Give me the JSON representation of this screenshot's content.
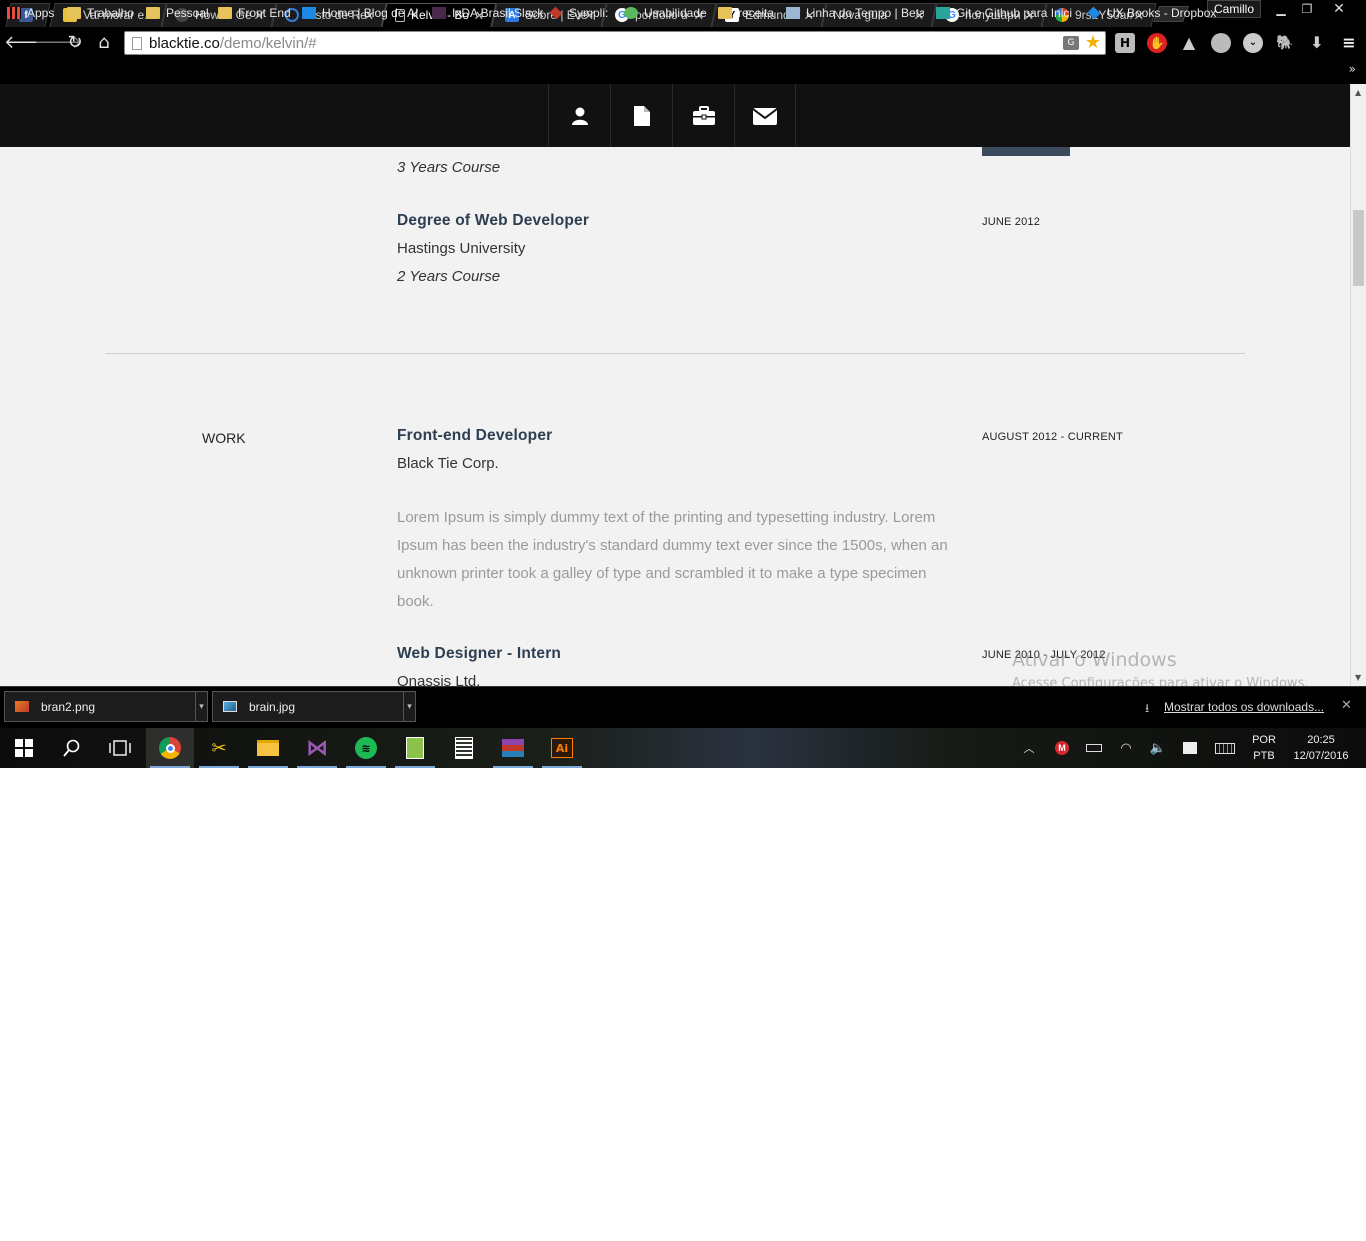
{
  "browser": {
    "tabs": [
      {
        "label": "",
        "icon": "facebook-icon",
        "color": "#3b5998",
        "glyph": "f"
      },
      {
        "label": "Vai morar e",
        "icon": "image-icon",
        "color": "#e8c13a",
        "glyph": ""
      },
      {
        "label": "How to Ge",
        "icon": "github-icon",
        "color": "#444444",
        "glyph": ""
      },
      {
        "label": "Visto de Re",
        "icon": "search-icon",
        "color": "#3a7bd5",
        "glyph": ""
      },
      {
        "label": "Kelvin - Bo",
        "icon": "page-icon",
        "color": "#ffffff",
        "glyph": "",
        "active": true
      },
      {
        "label": "Sobre | Eve",
        "icon": "evernote-icon",
        "color": "#2d7be0",
        "glyph": ""
      },
      {
        "label": "portfolio u",
        "icon": "google-icon",
        "color": "#ffffff",
        "glyph": "G"
      },
      {
        "label": "Edmund Y",
        "icon": "ym-icon",
        "color": "#ffffff",
        "glyph": "Y"
      },
      {
        "label": "Nova guia",
        "icon": "",
        "color": "",
        "glyph": ""
      },
      {
        "label": "полушари",
        "icon": "google-icon",
        "color": "#ffffff",
        "glyph": "G"
      },
      {
        "label": "9rs2Y50ar/",
        "icon": "pinwheel-icon",
        "color": "#e34a2a",
        "glyph": ""
      }
    ],
    "profile_name": "Camillo",
    "url_host": "blacktie.co",
    "url_path": "/demo/kelvin/#",
    "bookmarks": [
      {
        "label": "Apps",
        "icon": "apps-icon"
      },
      {
        "label": "Trabalho",
        "icon": "folder-icon"
      },
      {
        "label": "Pessoal",
        "icon": "folder-icon"
      },
      {
        "label": "Front End",
        "icon": "folder-icon"
      },
      {
        "label": "Home | Blog de AI",
        "icon": "ai-icon"
      },
      {
        "label": "IxDA Brasil Slack",
        "icon": "slack-icon"
      },
      {
        "label": "Sympli:",
        "icon": "sympli-icon"
      },
      {
        "label": "Usabilidade",
        "icon": "usability-icon"
      },
      {
        "label": "receita",
        "icon": "folder-icon"
      },
      {
        "label": "Linha do Tempo | Beta",
        "icon": "timeline-icon"
      },
      {
        "label": "Git e Github para Inici",
        "icon": "w-icon"
      },
      {
        "label": "UX Books - Dropbox",
        "icon": "dropbox-icon"
      }
    ]
  },
  "site": {
    "nav_icons": [
      "user-icon",
      "document-icon",
      "briefcase-icon",
      "envelope-icon"
    ],
    "education": {
      "prev_course_note": "3 Years Course",
      "item": {
        "title": "Degree of Web Developer",
        "school": "Hastings University",
        "duration": "2 Years Course",
        "date": "JUNE 2012"
      }
    },
    "work": {
      "section_label": "WORK",
      "items": [
        {
          "title": "Front-end Developer",
          "company": "Black Tie Corp.",
          "date": "AUGUST 2012 - CURRENT",
          "description": "Lorem Ipsum is simply dummy text of the printing and typesetting industry. Lorem Ipsum has been the industry's standard dummy text ever since the 1500s, when an unknown printer took a galley of type and scrambled it to make a type specimen book."
        },
        {
          "title": "Web Designer - Intern",
          "company": "Onassis Ltd.",
          "date": "JUNE 2010 - JULY 2012"
        }
      ]
    },
    "watermark": {
      "line1": "Ativar o Windows",
      "line2": "Acesse Configurações para ativar o Windows."
    }
  },
  "downloads": {
    "items": [
      {
        "filename": "bran2.png"
      },
      {
        "filename": "brain.jpg"
      }
    ],
    "show_all_label": "Mostrar todos os downloads..."
  },
  "taskbar": {
    "apps": [
      "chrome-icon",
      "tools-icon",
      "file-explorer-icon",
      "visual-studio-icon",
      "spotify-icon",
      "spreadsheet-icon",
      "calculator-icon",
      "winrar-icon",
      "illustrator-icon"
    ],
    "lang_top": "POR",
    "lang_bottom": "PTB",
    "time": "20:25",
    "date": "12/07/2016"
  },
  "colors": {
    "accent_title": "#2c3e50",
    "page_bg": "#f2f2f2",
    "nav_bg": "#111111",
    "lorem_text": "#9a9a9a"
  }
}
